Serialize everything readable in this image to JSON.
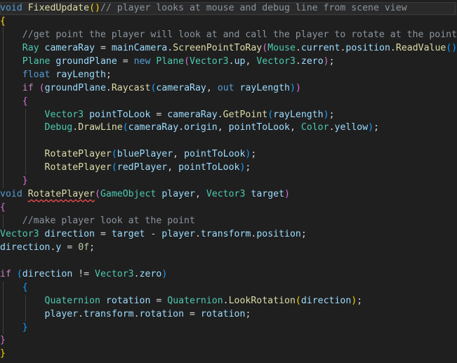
{
  "editor": {
    "lines": [
      {
        "current": true,
        "tokens": [
          [
            "kw",
            "void"
          ],
          [
            "wsp",
            " "
          ],
          [
            "fn",
            "FixedUpdate"
          ],
          [
            "bk1",
            "()"
          ],
          [
            "cm",
            "// player looks at mouse and debug line from scene view"
          ]
        ]
      },
      {
        "tokens": [
          [
            "bk1",
            "{"
          ]
        ]
      },
      {
        "tokens": [
          [
            "wsp",
            "    "
          ],
          [
            "cm",
            "//get point the player will look at and call the player to rotate at the point"
          ]
        ]
      },
      {
        "tokens": [
          [
            "wsp",
            "    "
          ],
          [
            "ty",
            "Ray"
          ],
          [
            "wsp",
            " "
          ],
          [
            "var",
            "cameraRay"
          ],
          [
            "op",
            " = "
          ],
          [
            "var",
            "mainCamera"
          ],
          [
            "op",
            "."
          ],
          [
            "fn",
            "ScreenPointToRay"
          ],
          [
            "bk2",
            "("
          ],
          [
            "ty",
            "Mouse"
          ],
          [
            "op",
            "."
          ],
          [
            "var",
            "current"
          ],
          [
            "op",
            "."
          ],
          [
            "var",
            "position"
          ],
          [
            "op",
            "."
          ],
          [
            "fn",
            "ReadValue"
          ],
          [
            "bk3",
            "()"
          ],
          [
            "bk2",
            ")"
          ],
          [
            "op",
            ";"
          ]
        ]
      },
      {
        "tokens": [
          [
            "wsp",
            "    "
          ],
          [
            "ty",
            "Plane"
          ],
          [
            "wsp",
            " "
          ],
          [
            "var",
            "groundPlane"
          ],
          [
            "op",
            " = "
          ],
          [
            "kw",
            "new"
          ],
          [
            "wsp",
            " "
          ],
          [
            "ty",
            "Plane"
          ],
          [
            "bk2",
            "("
          ],
          [
            "ty",
            "Vector3"
          ],
          [
            "op",
            "."
          ],
          [
            "var",
            "up"
          ],
          [
            "op",
            ", "
          ],
          [
            "ty",
            "Vector3"
          ],
          [
            "op",
            "."
          ],
          [
            "var",
            "zero"
          ],
          [
            "bk2",
            ")"
          ],
          [
            "op",
            ";"
          ]
        ]
      },
      {
        "tokens": [
          [
            "wsp",
            "    "
          ],
          [
            "kw",
            "float"
          ],
          [
            "wsp",
            " "
          ],
          [
            "var",
            "rayLength"
          ],
          [
            "op",
            ";"
          ]
        ]
      },
      {
        "tokens": [
          [
            "wsp",
            "    "
          ],
          [
            "ctl",
            "if"
          ],
          [
            "wsp",
            " "
          ],
          [
            "bk2",
            "("
          ],
          [
            "var",
            "groundPlane"
          ],
          [
            "op",
            "."
          ],
          [
            "fn",
            "Raycast"
          ],
          [
            "bk3",
            "("
          ],
          [
            "var",
            "cameraRay"
          ],
          [
            "op",
            ", "
          ],
          [
            "kw",
            "out"
          ],
          [
            "wsp",
            " "
          ],
          [
            "var",
            "rayLength"
          ],
          [
            "bk3",
            ")"
          ],
          [
            "bk2",
            ")"
          ]
        ]
      },
      {
        "tokens": [
          [
            "wsp",
            "    "
          ],
          [
            "bk2",
            "{"
          ]
        ]
      },
      {
        "tokens": [
          [
            "wsp",
            "        "
          ],
          [
            "ty",
            "Vector3"
          ],
          [
            "wsp",
            " "
          ],
          [
            "var",
            "pointToLook"
          ],
          [
            "op",
            " = "
          ],
          [
            "var",
            "cameraRay"
          ],
          [
            "op",
            "."
          ],
          [
            "fn",
            "GetPoint"
          ],
          [
            "bk3",
            "("
          ],
          [
            "var",
            "rayLength"
          ],
          [
            "bk3",
            ")"
          ],
          [
            "op",
            ";"
          ]
        ]
      },
      {
        "tokens": [
          [
            "wsp",
            "        "
          ],
          [
            "ty",
            "Debug"
          ],
          [
            "op",
            "."
          ],
          [
            "fn",
            "DrawLine"
          ],
          [
            "bk3",
            "("
          ],
          [
            "var",
            "cameraRay"
          ],
          [
            "op",
            "."
          ],
          [
            "var",
            "origin"
          ],
          [
            "op",
            ", "
          ],
          [
            "var",
            "pointToLook"
          ],
          [
            "op",
            ", "
          ],
          [
            "ty",
            "Color"
          ],
          [
            "op",
            "."
          ],
          [
            "var",
            "yellow"
          ],
          [
            "bk3",
            ")"
          ],
          [
            "op",
            ";"
          ]
        ]
      },
      {
        "tokens": []
      },
      {
        "tokens": [
          [
            "wsp",
            "        "
          ],
          [
            "fn",
            "RotatePlayer"
          ],
          [
            "bk3",
            "("
          ],
          [
            "var",
            "bluePlayer"
          ],
          [
            "op",
            ", "
          ],
          [
            "var",
            "pointToLook"
          ],
          [
            "bk3",
            ")"
          ],
          [
            "op",
            ";"
          ]
        ]
      },
      {
        "tokens": [
          [
            "wsp",
            "        "
          ],
          [
            "fn",
            "RotatePlayer"
          ],
          [
            "bk3",
            "("
          ],
          [
            "var",
            "redPlayer"
          ],
          [
            "op",
            ", "
          ],
          [
            "var",
            "pointToLook"
          ],
          [
            "bk3",
            ")"
          ],
          [
            "op",
            ";"
          ]
        ]
      },
      {
        "tokens": [
          [
            "wsp",
            "    "
          ],
          [
            "bk2",
            "}"
          ]
        ]
      },
      {
        "tokens": [
          [
            "kw",
            "void"
          ],
          [
            "wsp",
            " "
          ],
          [
            "fn",
            "RotatePlayer",
            "err"
          ],
          [
            "bk2",
            "("
          ],
          [
            "ty",
            "GameObject"
          ],
          [
            "wsp",
            " "
          ],
          [
            "pm",
            "player"
          ],
          [
            "op",
            ", "
          ],
          [
            "ty",
            "Vector3"
          ],
          [
            "wsp",
            " "
          ],
          [
            "pm",
            "target"
          ],
          [
            "bk2",
            ")"
          ]
        ]
      },
      {
        "tokens": [
          [
            "bk2",
            "{"
          ]
        ]
      },
      {
        "tokens": [
          [
            "wsp",
            "    "
          ],
          [
            "cm",
            "//make player look at the point"
          ]
        ]
      },
      {
        "tokens": [
          [
            "ty",
            "Vector3"
          ],
          [
            "wsp",
            " "
          ],
          [
            "var",
            "direction"
          ],
          [
            "op",
            " = "
          ],
          [
            "pm",
            "target"
          ],
          [
            "op",
            " - "
          ],
          [
            "pm",
            "player"
          ],
          [
            "op",
            "."
          ],
          [
            "var",
            "transform"
          ],
          [
            "op",
            "."
          ],
          [
            "var",
            "position"
          ],
          [
            "op",
            ";"
          ]
        ]
      },
      {
        "tokens": [
          [
            "var",
            "direction"
          ],
          [
            "op",
            "."
          ],
          [
            "var",
            "y"
          ],
          [
            "op",
            " = "
          ],
          [
            "num",
            "0f"
          ],
          [
            "op",
            ";"
          ]
        ]
      },
      {
        "tokens": []
      },
      {
        "tokens": [
          [
            "ctl",
            "if"
          ],
          [
            "wsp",
            " "
          ],
          [
            "bk3",
            "("
          ],
          [
            "var",
            "direction"
          ],
          [
            "op",
            " != "
          ],
          [
            "ty",
            "Vector3"
          ],
          [
            "op",
            "."
          ],
          [
            "var",
            "zero"
          ],
          [
            "bk3",
            ")"
          ]
        ]
      },
      {
        "tokens": [
          [
            "wsp",
            "    "
          ],
          [
            "bk3",
            "{"
          ]
        ]
      },
      {
        "tokens": [
          [
            "wsp",
            "        "
          ],
          [
            "ty",
            "Quaternion"
          ],
          [
            "wsp",
            " "
          ],
          [
            "var",
            "rotation"
          ],
          [
            "op",
            " = "
          ],
          [
            "ty",
            "Quaternion"
          ],
          [
            "op",
            "."
          ],
          [
            "fn",
            "LookRotation"
          ],
          [
            "bk1",
            "("
          ],
          [
            "var",
            "direction"
          ],
          [
            "bk1",
            ")"
          ],
          [
            "op",
            ";"
          ]
        ]
      },
      {
        "tokens": [
          [
            "wsp",
            "        "
          ],
          [
            "pm",
            "player"
          ],
          [
            "op",
            "."
          ],
          [
            "var",
            "transform"
          ],
          [
            "op",
            "."
          ],
          [
            "var",
            "rotation"
          ],
          [
            "op",
            " = "
          ],
          [
            "var",
            "rotation"
          ],
          [
            "op",
            ";"
          ]
        ]
      },
      {
        "tokens": [
          [
            "wsp",
            "    "
          ],
          [
            "bk3",
            "}"
          ]
        ]
      },
      {
        "tokens": [
          [
            "bk2",
            "}"
          ]
        ]
      },
      {
        "tokens": [
          [
            "bk1",
            "}"
          ]
        ]
      }
    ]
  }
}
